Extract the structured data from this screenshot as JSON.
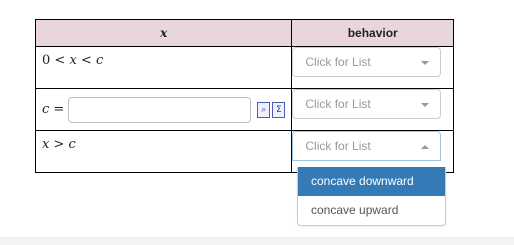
{
  "table": {
    "header_x": "x",
    "header_behavior": "behavior",
    "rows": [
      {
        "expr_a": "0",
        "lt1": "<",
        "var": "x",
        "lt2": "<",
        "expr_b": "c"
      },
      {
        "eq_var": "c",
        "eq_sign": "=",
        "input_value": ""
      },
      {
        "var": "x",
        "gt": ">",
        "expr_b": "c"
      }
    ]
  },
  "selects": {
    "placeholder": "Click for List",
    "options": [
      "concave downward",
      "concave upward"
    ],
    "highlighted_option": "concave downward"
  },
  "icons": {
    "preview": "preview-icon",
    "sigma": "sigma-icon"
  },
  "colors": {
    "header_bg": "#e9d6db",
    "option_highlight": "#337ab7"
  }
}
